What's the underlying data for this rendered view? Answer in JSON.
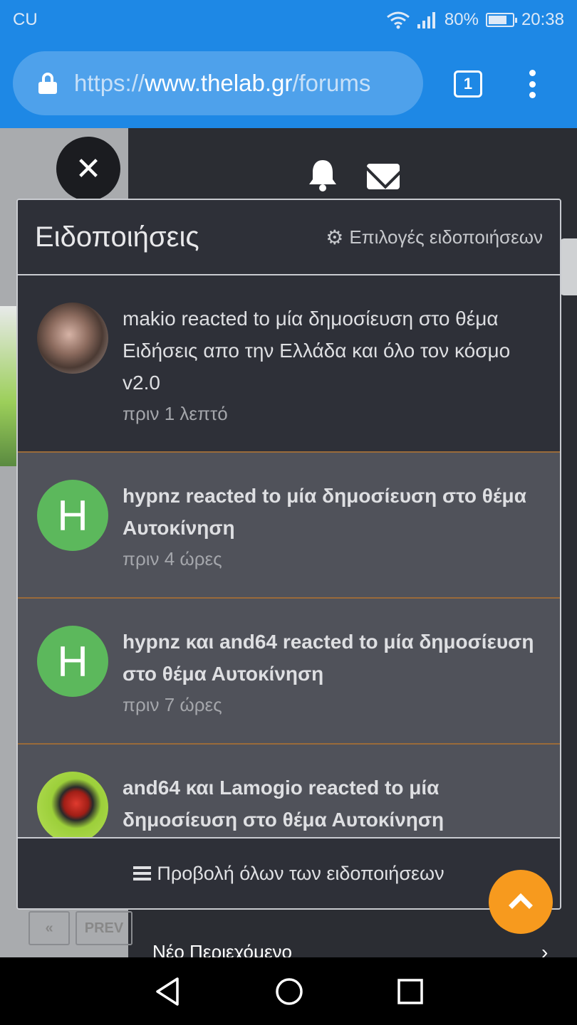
{
  "status_bar": {
    "carrier": "CU",
    "battery": "80%",
    "battery_level": 0.8,
    "time": "20:38"
  },
  "browser": {
    "url_scheme": "https://",
    "url_host": "www.thelab.gr",
    "url_path": "/forums",
    "tab_count": "1"
  },
  "background": {
    "pager_first": "«",
    "pager_prev": "PREV",
    "new_content": "Νέο Περιεχόμενο",
    "new_content_chevron": "›"
  },
  "panel": {
    "title": "Ειδοποιήσεις",
    "options_label": "Επιλογές ειδοποιήσεων",
    "footer_label": "Προβολή όλων των ειδοποιήσεων",
    "notifications": [
      {
        "text": "makio reacted to μία δημοσίευση στο θέμα Ειδήσεις απο την Ελλάδα και όλο τον κόσμο v2.0",
        "time": "πριν 1 λεπτό",
        "avatar_letter": ""
      },
      {
        "text": "hypnz reacted to μία δημοσίευση στο θέμα Αυτοκίνηση",
        "time": "πριν 4 ώρες",
        "avatar_letter": "H"
      },
      {
        "text": "hypnz και and64 reacted to μία δημοσίευση στο θέμα Αυτοκίνηση",
        "time": "πριν 7 ώρες",
        "avatar_letter": "H"
      },
      {
        "text": "and64 και Lamogio reacted to μία δημοσίευση στο θέμα Αυτοκίνηση",
        "time": "",
        "avatar_letter": ""
      }
    ]
  },
  "colors": {
    "accent": "#1e88e5",
    "fab": "#f79a1e",
    "avatar_green": "#5cb85c"
  }
}
